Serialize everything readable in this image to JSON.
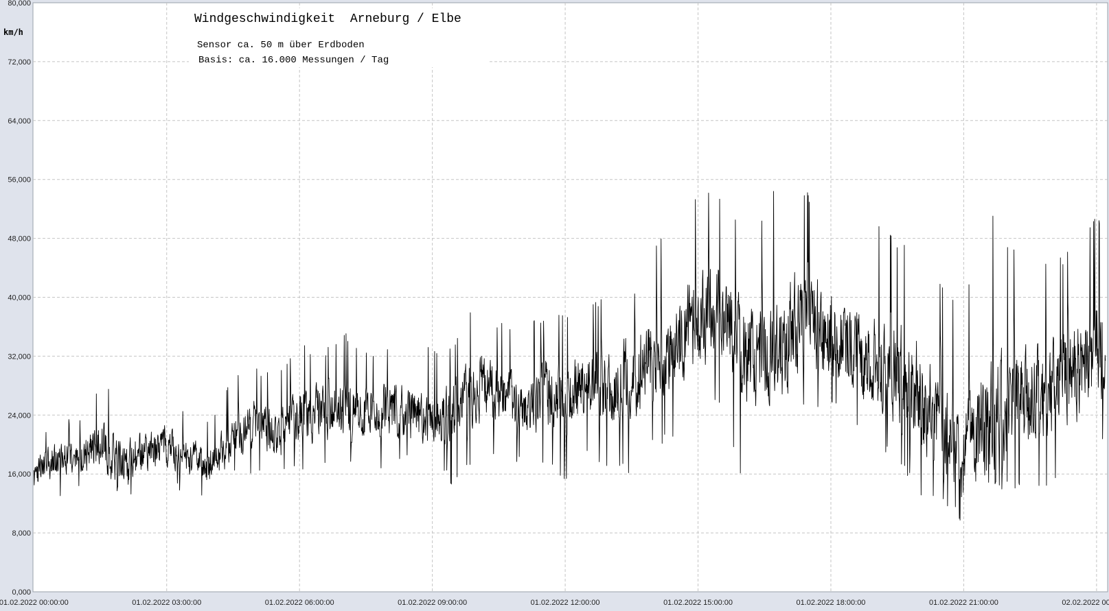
{
  "chart_data": {
    "type": "line",
    "title": "Windgeschwindigkeit  Arneburg / Elbe",
    "subtitle_lines": [
      "Sensor ca. 50 m über Erdboden",
      "Basis: ca. 16.000 Messungen / Tag"
    ],
    "ylabel": "km/h",
    "xlabel": "",
    "ylim": [
      0,
      80
    ],
    "y_ticks": [
      {
        "value": 0,
        "label": "0,000"
      },
      {
        "value": 8,
        "label": "8,000"
      },
      {
        "value": 16,
        "label": "16,000"
      },
      {
        "value": 24,
        "label": "24,000"
      },
      {
        "value": 32,
        "label": "32,000"
      },
      {
        "value": 40,
        "label": "40,000"
      },
      {
        "value": 48,
        "label": "48,000"
      },
      {
        "value": 56,
        "label": "56,000"
      },
      {
        "value": 64,
        "label": "64,000"
      },
      {
        "value": 72,
        "label": "72,000"
      },
      {
        "value": 80,
        "label": "80,000"
      }
    ],
    "x_ticks": [
      {
        "hour": 0,
        "label": "01.02.2022  00:00:00"
      },
      {
        "hour": 3,
        "label": "01.02.2022  03:00:00"
      },
      {
        "hour": 6,
        "label": "01.02.2022  06:00:00"
      },
      {
        "hour": 9,
        "label": "01.02.2022  09:00:00"
      },
      {
        "hour": 12,
        "label": "01.02.2022  12:00:00"
      },
      {
        "hour": 15,
        "label": "01.02.2022  15:00:00"
      },
      {
        "hour": 18,
        "label": "01.02.2022  18:00:00"
      },
      {
        "hour": 21,
        "label": "01.02.2022  21:00:00"
      },
      {
        "hour": 24,
        "label": "02.02.2022  00:00:00"
      }
    ],
    "xlim_hours": [
      -0.02,
      24.25
    ],
    "grid": true,
    "series": [
      {
        "color": "#000000",
        "x_hours": [
          0,
          0.5,
          1,
          1.5,
          2,
          2.5,
          3,
          3.5,
          4,
          4.5,
          5,
          5.5,
          6,
          6.5,
          7,
          7.5,
          8,
          8.5,
          9,
          9.5,
          10,
          10.5,
          11,
          11.5,
          12,
          12.5,
          13,
          13.5,
          14,
          14.5,
          15,
          15.5,
          16,
          16.5,
          17,
          17.5,
          18,
          18.5,
          19,
          19.5,
          20,
          20.5,
          21,
          21.5,
          22,
          22.5,
          23,
          23.5,
          24,
          24.2
        ],
        "mean_kmh": [
          16,
          18,
          18,
          20,
          17,
          19,
          20,
          18,
          17,
          21,
          23,
          21,
          24,
          24,
          25,
          24,
          25,
          24,
          23,
          24,
          28,
          27,
          25,
          27,
          26,
          28,
          28,
          29,
          32,
          34,
          37,
          38,
          33,
          32,
          35,
          37,
          35,
          33,
          31,
          30,
          27,
          24,
          18,
          23,
          26,
          27,
          28,
          30,
          33,
          32
        ],
        "min_kmh": [
          12,
          13,
          13,
          14,
          12,
          14,
          14,
          13,
          11,
          15,
          16,
          16,
          16,
          16,
          17,
          16,
          17,
          18,
          17,
          14,
          18,
          18,
          17,
          17,
          15,
          18,
          17,
          16,
          20,
          20,
          24,
          25,
          15,
          22,
          23,
          25,
          25,
          22,
          20,
          17,
          13,
          12,
          9,
          13,
          14,
          14,
          14,
          17,
          20,
          19
        ],
        "max_kmh": [
          22,
          24,
          24,
          29,
          27,
          27,
          27,
          25,
          24,
          29,
          31,
          30,
          34,
          33,
          36,
          33,
          34,
          35,
          33,
          34,
          40,
          37,
          36,
          38,
          38,
          40,
          40,
          41,
          48,
          50,
          55,
          54,
          49,
          52,
          59,
          54,
          56,
          52,
          50,
          48,
          46,
          43,
          38,
          54,
          48,
          46,
          44,
          48,
          52,
          50
        ]
      }
    ]
  }
}
